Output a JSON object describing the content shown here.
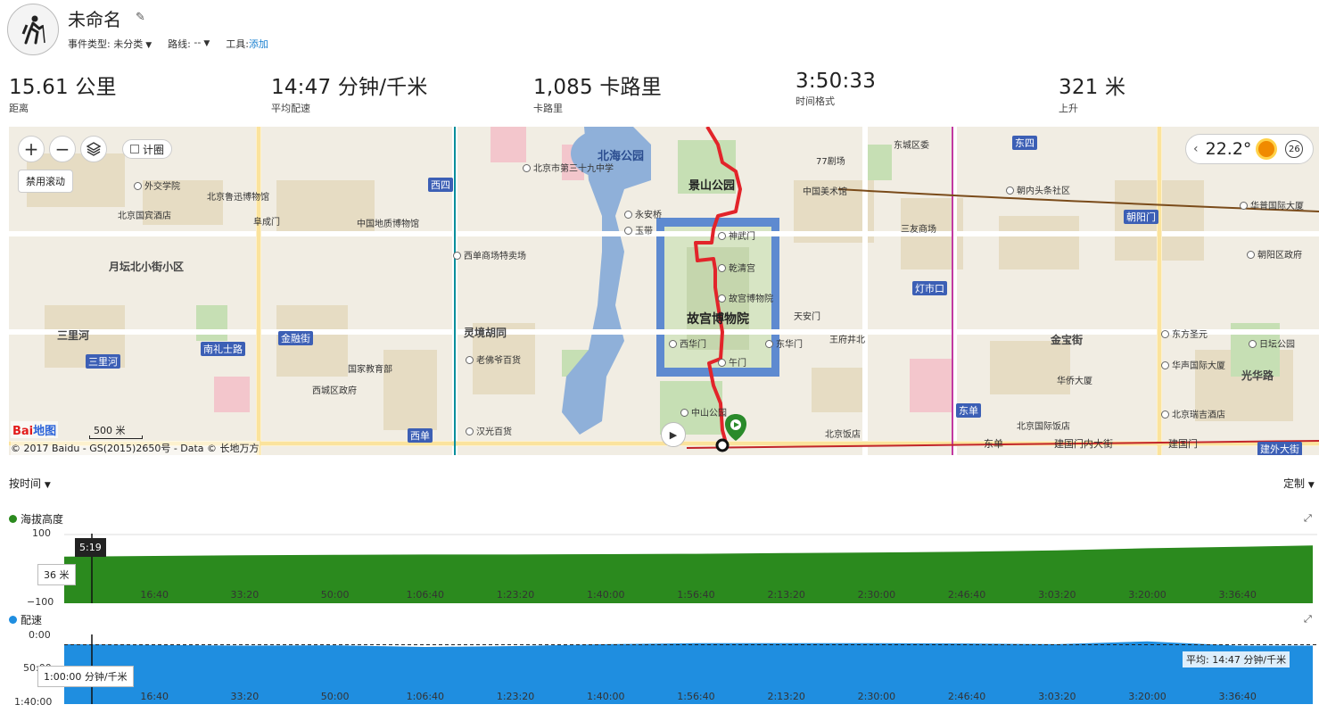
{
  "activity": {
    "title": "未命名",
    "icon": "hiking-icon",
    "event_type_label": "事件类型:",
    "event_type_value": "未分类",
    "course_label": "路线:",
    "course_value": "--",
    "tools_label": "工具:",
    "tools_link": "添加"
  },
  "stats": [
    {
      "value": "15.61 公里",
      "label": "距离"
    },
    {
      "value": "14:47 分钟/千米",
      "label": "平均配速"
    },
    {
      "value": "1,085 卡路里",
      "label": "卡路里"
    },
    {
      "value": "3:50:33",
      "label": "时间格式"
    },
    {
      "value": "321 米",
      "label": "上升"
    }
  ],
  "map": {
    "zoom_in": "+",
    "zoom_out": "−",
    "layers_icon": "layers-icon",
    "heatmap_label": "计圈",
    "disable_scroll": "禁用滚动",
    "weather_temp": "22.2°",
    "weather_icon": "sun-icon",
    "wind_value": "26",
    "scale": "500 米",
    "copyright": "© 2017 Baidu - GS(2015)2650号 - Data © 长地万方",
    "logo_text": "Bai",
    "logo_text2": "地图",
    "labels": {
      "beihai_park": "北海公园",
      "jingshan_park": "景山公园",
      "forbidden_city": "故宫博物院",
      "yuetan": "月坛北小街小区",
      "sanlihe": "三里河",
      "shenwumen": "神武门",
      "qianqinggong": "乾清宫",
      "gugong": "故宫博物院",
      "xihuamen": "西华门",
      "donghuamen": "东华门",
      "wumen": "午门",
      "zhongshan": "中山公园",
      "tiananmen": "天安门",
      "wangfujing": "王府井北",
      "dongsi": "东四",
      "dengshikou": "灯市口",
      "jinbaojie": "金宝街",
      "chaoyangmen": "朝阳门",
      "xisi": "西四",
      "xidan": "西单",
      "lingjing": "灵境胡同",
      "fuchengmen": "阜成门",
      "jianguomen": "建国门内大街",
      "guanghua": "光华路",
      "dongdan": "东单",
      "guojiaojiaoyubu": "国家教育部",
      "xichengqu": "西城区政府",
      "laofo": "老佛爷百货",
      "hanguang": "汉光百货",
      "chaoyangqu": "朝阳区政府",
      "dongcheng": "东城区委",
      "huapu": "华普国际大厦",
      "zhongguo_meishu": "中国美术馆",
      "sanyou": "三友商场",
      "nanlishi": "南礼士路",
      "jinrongjie": "金融街",
      "waijiaoxueyuan": "外交学院",
      "lufeng": "北京鲁迅博物馆",
      "guoyuan": "北京国宾酒店",
      "zhongguo_dizhi": "中国地质博物馆",
      "xidan_shang": "西单商场特卖场",
      "beijing_32": "北京市第三十九中学",
      "yong_an": "永安桥",
      "yudai": "玉带",
      "beihai_gy": "北海公园",
      "jingshan_gy": "景山公园",
      "77": "77剧场",
      "chaonei": "朝内头条社区",
      "dongfang": "东方圣元",
      "ri_tan": "日坛公园",
      "huasheng": "华声国际大厦",
      "huaqiao": "华侨大厦",
      "beijing_fandian": "北京饭店",
      "beijing_guoji": "北京国际饭店",
      "ruiji": "北京瑞吉酒店",
      "dongdan_st": "东单",
      "jianguomen_st": "建国门",
      "jianwai": "建外大街"
    }
  },
  "controls": {
    "by_time": "按时间",
    "custom": "定制"
  },
  "charts": {
    "x_ticks": [
      "16:40",
      "33:20",
      "50:00",
      "1:06:40",
      "1:23:20",
      "1:40:00",
      "1:56:40",
      "2:13:20",
      "2:30:00",
      "2:46:40",
      "3:03:20",
      "3:20:00",
      "3:36:40"
    ],
    "elevation": {
      "title": "海拔高度",
      "color": "#2b8a1e",
      "y_max_label": "100",
      "y_min_label": "−100",
      "cursor_time": "5:19",
      "cursor_value": "36 米"
    },
    "pace": {
      "title": "配速",
      "color": "#1f8ee0",
      "y_top_label": "0:00",
      "y_mid_label": "50:00",
      "y_bottom_label": "1:40:00",
      "cursor_value": "1:00:00 分钟/千米",
      "average_label": "平均:  14:47 分钟/千米"
    }
  },
  "chart_data": [
    {
      "type": "area",
      "title": "海拔高度",
      "ylabel": "",
      "ylim": [
        -100,
        100
      ],
      "x": [
        "0:00",
        "16:40",
        "33:20",
        "50:00",
        "1:06:40",
        "1:23:20",
        "1:40:00",
        "1:56:40",
        "2:13:20",
        "2:30:00",
        "2:46:40",
        "3:03:20",
        "3:20:00",
        "3:36:40",
        "3:50:33"
      ],
      "series": [
        {
          "name": "",
          "values": [
            34,
            36,
            38,
            39,
            40,
            40,
            41,
            42,
            44,
            46,
            48,
            52,
            58,
            62,
            66
          ]
        }
      ]
    },
    {
      "type": "area",
      "title": "配速",
      "ylabel": "",
      "ylim": [
        "0:00",
        "1:40:00"
      ],
      "x": [
        "0:00",
        "16:40",
        "33:20",
        "50:00",
        "1:06:40",
        "1:23:20",
        "1:40:00",
        "1:56:40",
        "2:13:20",
        "2:30:00",
        "2:46:40",
        "3:03:20",
        "3:20:00",
        "3:36:40"
      ],
      "series": [
        {
          "name": "",
          "values": [
            "14:00",
            "15:00",
            "16:00",
            "15:30",
            "18:00",
            "16:40",
            "14:00",
            "12:30",
            "12:30",
            "12:30",
            "13:00",
            "14:00",
            "10:00",
            "16:00"
          ]
        }
      ],
      "annotations": [
        "平均:  14:47 分钟/千米"
      ]
    }
  ]
}
